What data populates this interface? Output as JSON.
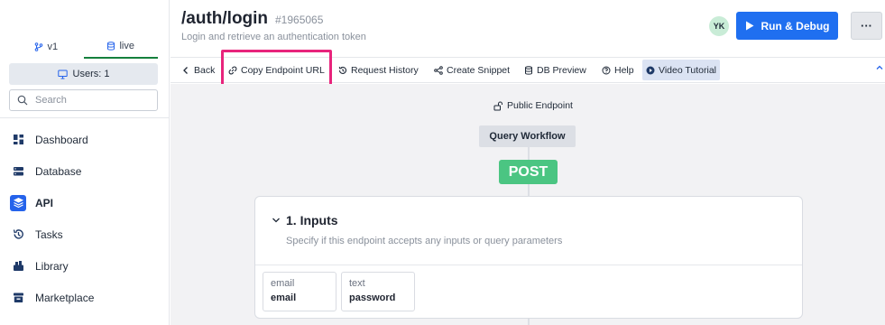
{
  "sidebar": {
    "branch_tabs": [
      {
        "label": "v1",
        "icon": "branch-icon",
        "active": false
      },
      {
        "label": "live",
        "icon": "database-icon",
        "active": true
      }
    ],
    "users_label": "Users: 1",
    "search_placeholder": "Search",
    "nav_items": [
      {
        "label": "Dashboard",
        "icon": "dashboard-icon",
        "active": false
      },
      {
        "label": "Database",
        "icon": "database-icon",
        "active": false
      },
      {
        "label": "API",
        "icon": "api-icon",
        "active": true
      },
      {
        "label": "Tasks",
        "icon": "tasks-icon",
        "active": false
      },
      {
        "label": "Library",
        "icon": "library-icon",
        "active": false
      },
      {
        "label": "Marketplace",
        "icon": "marketplace-icon",
        "active": false
      }
    ]
  },
  "header": {
    "title": "/auth/login",
    "endpoint_id": "#1965065",
    "subtitle": "Login and retrieve an authentication token",
    "avatar_initials": "YK",
    "run_label": "Run & Debug",
    "more_label": "···"
  },
  "toolbar": {
    "back": "Back",
    "copy_url": "Copy Endpoint URL",
    "request_history": "Request History",
    "create_snippet": "Create Snippet",
    "db_preview": "DB Preview",
    "help": "Help",
    "video_tutorial": "Video Tutorial"
  },
  "canvas": {
    "public_endpoint": "Public Endpoint",
    "workflow_label": "Query Workflow",
    "method": "POST",
    "inputs": {
      "title": "1. Inputs",
      "description": "Specify if this endpoint accepts any inputs or query parameters",
      "params": [
        {
          "type": "email",
          "name": "email"
        },
        {
          "type": "text",
          "name": "password"
        }
      ]
    }
  },
  "colors": {
    "primary": "#1f6ff0",
    "active_branch": "#15803d",
    "post_badge": "#4bc582",
    "highlight": "#e8247c",
    "avatar_bg": "#c9ecd7"
  }
}
